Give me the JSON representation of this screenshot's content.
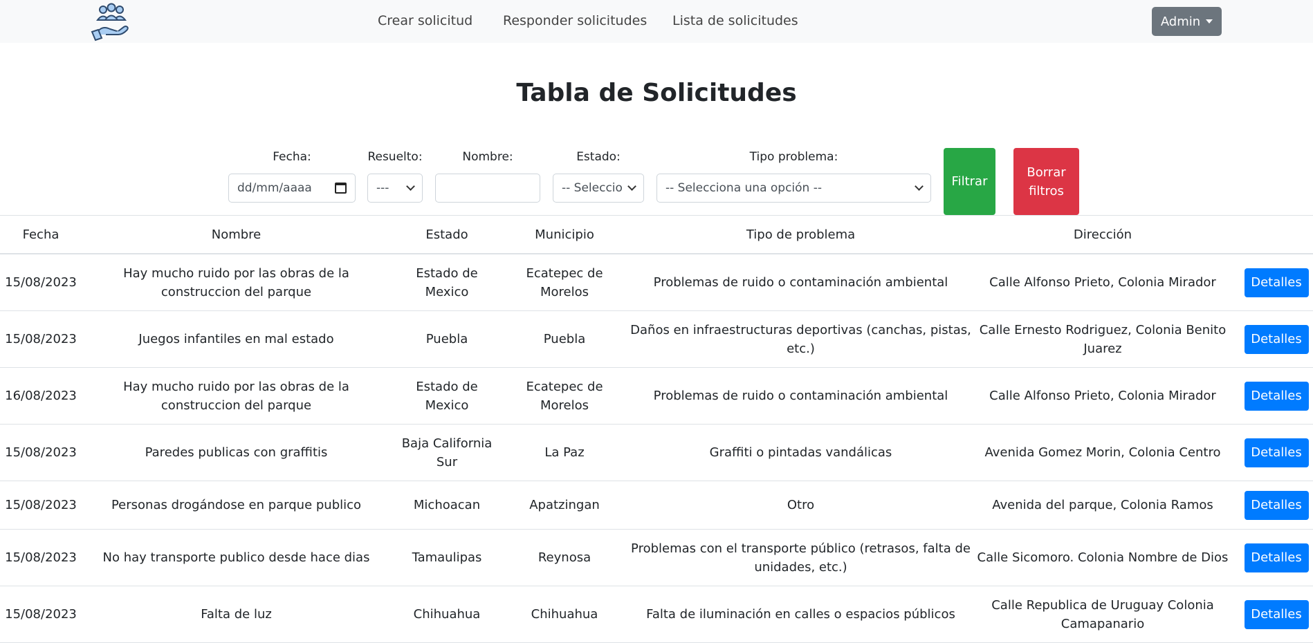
{
  "nav": {
    "links": [
      "Crear solicitud",
      "Responder solicitudes",
      "Lista de solicitudes"
    ],
    "admin_label": "Admin",
    "logo_icon": "people-hand-icon"
  },
  "title": "Tabla de Solicitudes",
  "filters": {
    "fecha_label": "Fecha:",
    "fecha_placeholder": "dd/mm/aaaa",
    "resuelto_label": "Resuelto:",
    "resuelto_value": "---",
    "nombre_label": "Nombre:",
    "nombre_value": "",
    "estado_label": "Estado:",
    "estado_value": "-- Seleccio",
    "tipo_label": "Tipo problema:",
    "tipo_value": "-- Selecciona una opción --",
    "filter_button": "Filtrar",
    "clear_button": "Borrar filtros"
  },
  "table": {
    "headers": [
      "Fecha",
      "Nombre",
      "Estado",
      "Municipio",
      "Tipo de problema",
      "Dirección"
    ],
    "action_label": "Detalles",
    "rows": [
      {
        "fecha": "15/08/2023",
        "nombre": "Hay mucho ruido por las obras de la construccion del parque",
        "estado": "Estado de Mexico",
        "municipio": "Ecatepec de Morelos",
        "tipo": "Problemas de ruido o contaminación ambiental",
        "direccion": "Calle Alfonso Prieto, Colonia Mirador"
      },
      {
        "fecha": "15/08/2023",
        "nombre": "Juegos infantiles en mal estado",
        "estado": "Puebla",
        "municipio": "Puebla",
        "tipo": "Daños en infraestructuras deportivas (canchas, pistas, etc.)",
        "direccion": "Calle Ernesto Rodriguez, Colonia Benito Juarez"
      },
      {
        "fecha": "16/08/2023",
        "nombre": "Hay mucho ruido por las obras de la construccion del parque",
        "estado": "Estado de Mexico",
        "municipio": "Ecatepec de Morelos",
        "tipo": "Problemas de ruido o contaminación ambiental",
        "direccion": "Calle Alfonso Prieto, Colonia Mirador"
      },
      {
        "fecha": "15/08/2023",
        "nombre": "Paredes publicas con graffitis",
        "estado": "Baja California Sur",
        "municipio": "La Paz",
        "tipo": "Graffiti o pintadas vandálicas",
        "direccion": "Avenida Gomez Morin, Colonia Centro"
      },
      {
        "fecha": "15/08/2023",
        "nombre": "Personas drogándose en parque publico",
        "estado": "Michoacan",
        "municipio": "Apatzingan",
        "tipo": "Otro",
        "direccion": "Avenida del parque, Colonia Ramos"
      },
      {
        "fecha": "15/08/2023",
        "nombre": "No hay transporte publico desde hace dias",
        "estado": "Tamaulipas",
        "municipio": "Reynosa",
        "tipo": "Problemas con el transporte público (retrasos, falta de unidades, etc.)",
        "direccion": "Calle Sicomoro. Colonia Nombre de Dios"
      },
      {
        "fecha": "15/08/2023",
        "nombre": "Falta de luz",
        "estado": "Chihuahua",
        "municipio": "Chihuahua",
        "tipo": "Falta de iluminación en calles o espacios públicos",
        "direccion": "Calle Republica de Uruguay Colonia Camapanario"
      }
    ]
  },
  "colors": {
    "navbar_bg": "#f8f9fa",
    "admin_bg": "#6c757d",
    "filter_green": "#28a745",
    "clear_red": "#dc3545",
    "details_blue": "#007bff"
  }
}
